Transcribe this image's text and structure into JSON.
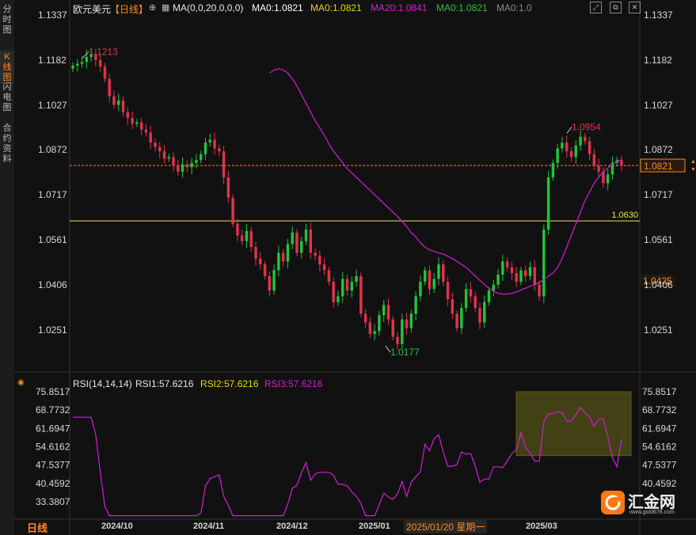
{
  "sidebar": {
    "tabs": [
      {
        "label": "分时图",
        "active": false
      },
      {
        "label": "K线图",
        "active": true
      },
      {
        "label": "闪电图",
        "active": false
      },
      {
        "label": "合约资料",
        "active": false
      }
    ]
  },
  "header": {
    "symbol": "欧元美元",
    "period": "【日线】",
    "ma_params": "MA(0,0,20,0,0,0)",
    "ma_values": [
      {
        "label": "MA0:1.0821",
        "color": "#ffffff"
      },
      {
        "label": "MA0:1.0821",
        "color": "#e6d600"
      },
      {
        "label": "MA20:1.0841",
        "color": "#d21fd2"
      },
      {
        "label": "MA0:1.0821",
        "color": "#22c33a"
      },
      {
        "label": "MA0:1.0",
        "color": "#8a8a8a"
      }
    ],
    "window_buttons": [
      "expand-icon",
      "restore-icon",
      "close-icon"
    ]
  },
  "price_axis": {
    "left_ticks": [
      "1.1337",
      "1.1182",
      "1.1027",
      "1.0872",
      "1.0717",
      "1.0561",
      "1.0406",
      "1.0251"
    ],
    "right_ticks": [
      "1.1337",
      "1.1182",
      "1.1027",
      "1.0872",
      "1.0717",
      "1.0561",
      "1.0406",
      "1.0251"
    ],
    "current_price_tag": "1.0821",
    "cursor_price_tag": "1.0425",
    "hline_label": "1.0630"
  },
  "annotations": {
    "high_left": "1.1213",
    "high_right": "1.0954",
    "low": "1.0177"
  },
  "rsi": {
    "params": "RSI(14,14,14)",
    "rsi1": "RSI1:57.6216",
    "rsi2": "RSI2:57.6216",
    "rsi3": "RSI3:57.6216",
    "ticks": [
      "75.8517",
      "68.7732",
      "61.6947",
      "54.6162",
      "47.5377",
      "40.4592",
      "33.3807"
    ],
    "right_ticks": [
      "75.8517",
      "68.7732",
      "61.6947",
      "54.6162",
      "47.5377",
      "40.4592"
    ]
  },
  "time_axis": {
    "period_label": "日线",
    "months": [
      "2024/10",
      "2024/11",
      "2024/12",
      "2025/01",
      "2025/03"
    ],
    "cursor_date": "2025/01/20 星期一"
  },
  "watermark": {
    "brand": "汇金网",
    "url": "www.gold678.com"
  },
  "colors": {
    "up": "#22c33a",
    "down": "#e0334a",
    "ma20": "#d21fd2",
    "accent": "#ff8a1f",
    "hline": "#f0e64a"
  },
  "chart_data": {
    "type": "candlestick",
    "instrument": "欧元美元",
    "timeframe": "日线",
    "price_range": [
      1.0177,
      1.1337
    ],
    "key_levels": {
      "current": 1.0821,
      "horizontal_line": 1.063,
      "cursor": 1.0425
    },
    "extremes": {
      "high_1": 1.1213,
      "high_2": 1.0954,
      "low": 1.0177
    },
    "candles_close": [
      1.1165,
      1.1172,
      1.1178,
      1.1195,
      1.1205,
      1.1185,
      1.1162,
      1.112,
      1.106,
      1.103,
      1.1045,
      1.1005,
      1.0985,
      1.0965,
      1.097,
      1.0945,
      1.0935,
      1.09,
      1.0885,
      1.087,
      1.0845,
      1.085,
      1.082,
      1.08,
      1.0825,
      1.0815,
      1.083,
      1.084,
      1.086,
      1.09,
      1.091,
      1.088,
      1.087,
      1.078,
      1.071,
      1.062,
      1.058,
      1.056,
      1.0595,
      1.054,
      1.05,
      1.048,
      1.044,
      1.039,
      1.046,
      1.052,
      1.049,
      1.055,
      1.059,
      1.052,
      1.056,
      1.06,
      1.052,
      1.051,
      1.048,
      1.046,
      1.042,
      1.035,
      1.037,
      1.043,
      1.039,
      1.042,
      1.044,
      1.031,
      1.028,
      1.024,
      1.025,
      1.0305,
      1.034,
      1.029,
      1.023,
      1.0205,
      1.029,
      1.026,
      1.031,
      1.037,
      1.042,
      1.046,
      1.0395,
      1.043,
      1.048,
      1.042,
      1.036,
      1.031,
      1.026,
      1.033,
      1.0395,
      1.037,
      1.033,
      1.028,
      1.035,
      1.039,
      1.041,
      1.0445,
      1.049,
      1.047,
      1.045,
      1.042,
      1.046,
      1.044,
      1.047,
      1.041,
      1.037,
      1.06,
      1.078,
      1.083,
      1.088,
      1.09,
      1.087,
      1.085,
      1.089,
      1.092,
      1.0905,
      1.086,
      1.082,
      1.08,
      1.076,
      1.079,
      1.083,
      1.084,
      1.0821
    ],
    "ma20": [
      1.114,
      1.115,
      1.1155,
      1.115,
      1.114,
      1.112,
      1.1095,
      1.1065,
      1.1035,
      1.1005,
      1.0975,
      1.095,
      1.0925,
      1.0895,
      1.087,
      1.085,
      1.083,
      1.081,
      1.0795,
      1.078,
      1.0765,
      1.075,
      1.0735,
      1.072,
      1.0705,
      1.069,
      1.0675,
      1.066,
      1.0645,
      1.0628,
      1.061,
      1.059,
      1.0575,
      1.0555,
      1.054,
      1.053,
      1.0525,
      1.052,
      1.0515,
      1.0508,
      1.05,
      1.049,
      1.048,
      1.047,
      1.0455,
      1.044,
      1.0425,
      1.041,
      1.0398,
      1.0388,
      1.038,
      1.0377,
      1.0378,
      1.038,
      1.0385,
      1.0392,
      1.0398,
      1.0405,
      1.041,
      1.0418,
      1.0428,
      1.044,
      1.045,
      1.047,
      1.05,
      1.054,
      1.058,
      1.062,
      1.066,
      1.07,
      1.073,
      1.076,
      1.078,
      1.08,
      1.0812,
      1.0825,
      1.0835,
      1.0841
    ],
    "rsi_range": [
      33.3807,
      75.8517
    ],
    "rsi_last": 57.6216
  }
}
